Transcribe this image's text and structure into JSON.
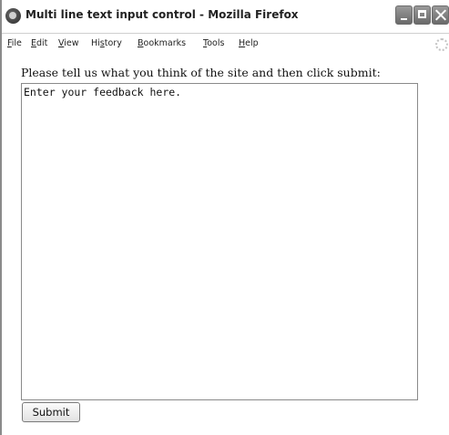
{
  "window": {
    "title": "Multi line text input control - Mozilla Firefox"
  },
  "menu": {
    "items": [
      {
        "label": "File",
        "accel": "F",
        "rest": "ile"
      },
      {
        "label": "Edit",
        "accel": "E",
        "rest": "dit"
      },
      {
        "label": "View",
        "accel": "V",
        "rest": "iew"
      },
      {
        "label": "History",
        "accel_pre": "Hi",
        "accel": "s",
        "rest": "tory"
      },
      {
        "label": "Bookmarks",
        "accel": "B",
        "rest": "ookmarks"
      },
      {
        "label": "Tools",
        "accel": "T",
        "rest": "ools"
      },
      {
        "label": "Help",
        "accel": "H",
        "rest": "elp"
      }
    ]
  },
  "form": {
    "prompt": "Please tell us what you think of the site and then click submit:",
    "feedback_value": "Enter your feedback here.",
    "submit_label": "Submit"
  },
  "icons": {
    "app": "firefox-icon",
    "minimize": "minimize-icon",
    "maximize": "maximize-icon",
    "close": "close-icon",
    "throbber": "throbber-icon"
  }
}
